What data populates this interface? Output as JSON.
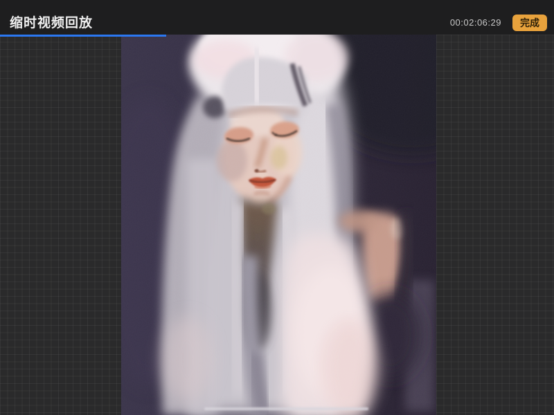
{
  "header": {
    "title": "缩时视频回放",
    "timestamp": "00:02:06:29",
    "done_label": "完成"
  },
  "playback": {
    "progress_percent": 30,
    "progress_style": "width:30%",
    "accent_color": "#2b78f2",
    "done_button_color": "#e8a23c"
  }
}
